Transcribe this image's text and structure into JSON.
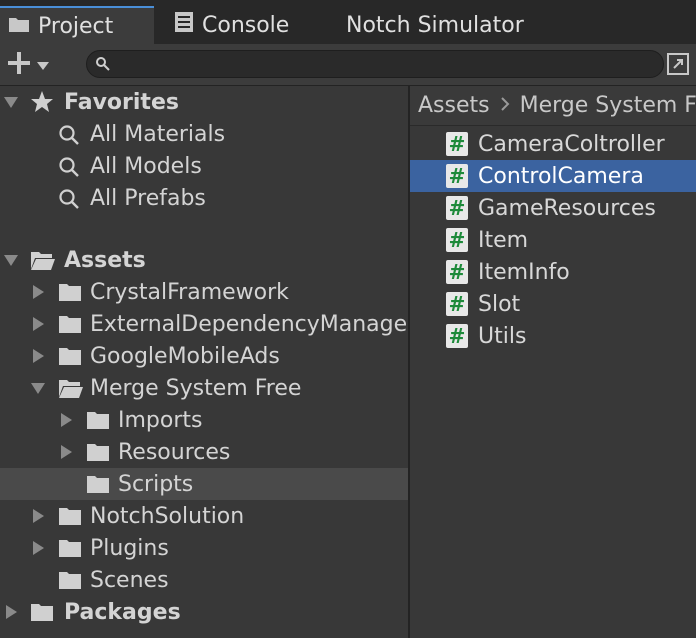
{
  "tabs": [
    {
      "label": "Project",
      "icon": "folder-icon",
      "active": true
    },
    {
      "label": "Console",
      "icon": "console-icon",
      "active": false
    },
    {
      "label": "Notch Simulator",
      "icon": "",
      "active": false
    }
  ],
  "toolbar": {
    "add_label": "+",
    "search_placeholder": "",
    "search_value": ""
  },
  "tree": {
    "favorites": {
      "label": "Favorites",
      "items": [
        "All Materials",
        "All Models",
        "All Prefabs"
      ]
    },
    "assets": {
      "label": "Assets",
      "items": [
        {
          "label": "CrystalFramework"
        },
        {
          "label": "ExternalDependencyManager"
        },
        {
          "label": "GoogleMobileAds"
        },
        {
          "label": "Merge System Free"
        },
        {
          "label": "Imports"
        },
        {
          "label": "Resources"
        },
        {
          "label": "Scripts"
        },
        {
          "label": "NotchSolution"
        },
        {
          "label": "Plugins"
        },
        {
          "label": "Scenes"
        }
      ]
    },
    "packages": {
      "label": "Packages"
    }
  },
  "breadcrumb": [
    "Assets",
    "Merge System Free"
  ],
  "files": [
    {
      "name": "CameraColtroller",
      "selected": false
    },
    {
      "name": "ControlCamera",
      "selected": true
    },
    {
      "name": "GameResources",
      "selected": false
    },
    {
      "name": "Item",
      "selected": false
    },
    {
      "name": "ItemInfo",
      "selected": false
    },
    {
      "name": "Slot",
      "selected": false
    },
    {
      "name": "Utils",
      "selected": false
    }
  ],
  "colors": {
    "selection": "#3b63a0",
    "script_hash": "#1d8a3a",
    "tab_accent": "#4a8fd8"
  }
}
